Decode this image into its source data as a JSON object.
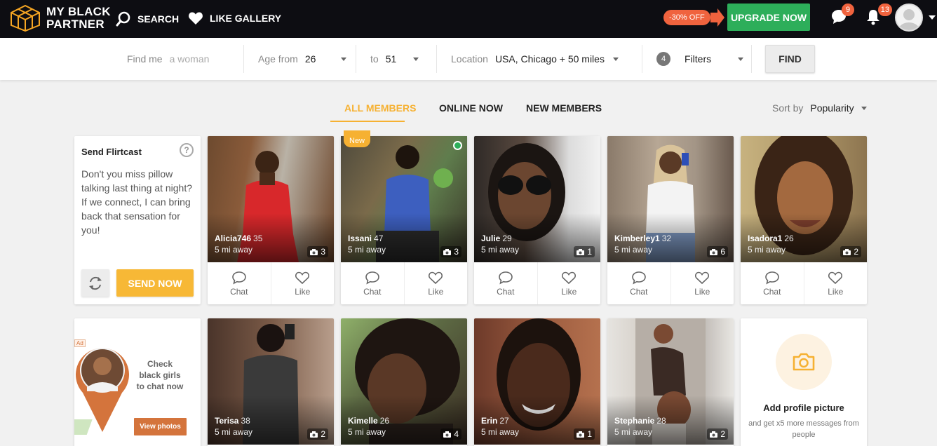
{
  "header": {
    "logo_line1": "MY BLACK",
    "logo_line2": "PARTNER",
    "search_label": "SEARCH",
    "like_gallery_label": "LIKE GALLERY",
    "discount_label": "-30% OFF",
    "upgrade_label": "UPGRADE NOW",
    "messages_count": "9",
    "notifications_count": "13",
    "accent_color": "#f6b132",
    "upgrade_color": "#2dae5a",
    "discount_color": "#f0633e"
  },
  "filters": {
    "find_me_label": "Find me",
    "find_me_value": "a woman",
    "age_from_label": "Age from",
    "age_from_value": "26",
    "age_to_label": "to",
    "age_to_value": "51",
    "location_label": "Location",
    "location_value": "USA, Chicago + 50 miles",
    "filters_count": "4",
    "filters_label": "Filters",
    "find_label": "FIND"
  },
  "tabs": [
    {
      "label": "ALL MEMBERS",
      "active": true
    },
    {
      "label": "ONLINE NOW",
      "active": false
    },
    {
      "label": "NEW MEMBERS",
      "active": false
    }
  ],
  "sort": {
    "label": "Sort by",
    "value": "Popularity"
  },
  "flirtcast": {
    "title": "Send Flirtcast",
    "help": "?",
    "message": "Don't you miss pillow talking last thing at night? If we connect, I can bring back that sensation for you!",
    "send_label": "SEND NOW"
  },
  "actions": {
    "chat_label": "Chat",
    "like_label": "Like"
  },
  "members": [
    {
      "name": "Alicia746",
      "age": "35",
      "distance": "5 mi away",
      "photos": "3"
    },
    {
      "name": "Issani",
      "age": "47",
      "distance": "5 mi away",
      "photos": "3",
      "badge": "New",
      "online": true
    },
    {
      "name": "Julie",
      "age": "29",
      "distance": "5 mi away",
      "photos": "1"
    },
    {
      "name": "Kimberley1",
      "age": "32",
      "distance": "5 mi away",
      "photos": "6"
    },
    {
      "name": "Isadora1",
      "age": "26",
      "distance": "5 mi away",
      "photos": "2"
    },
    {
      "name": "Terisa",
      "age": "38",
      "distance": "5 mi away",
      "photos": "2"
    },
    {
      "name": "Kimelle",
      "age": "26",
      "distance": "5 mi away",
      "photos": "4"
    },
    {
      "name": "Erin",
      "age": "27",
      "distance": "5 mi away",
      "photos": "1"
    },
    {
      "name": "Stephanie",
      "age": "28",
      "distance": "5 mi away",
      "photos": "2"
    }
  ],
  "ad": {
    "tag": "Ad",
    "text": "Check black girls to chat now",
    "button_label": "View photos"
  },
  "add_picture": {
    "title": "Add profile picture",
    "subtitle": "and get x5 more messages from people"
  }
}
